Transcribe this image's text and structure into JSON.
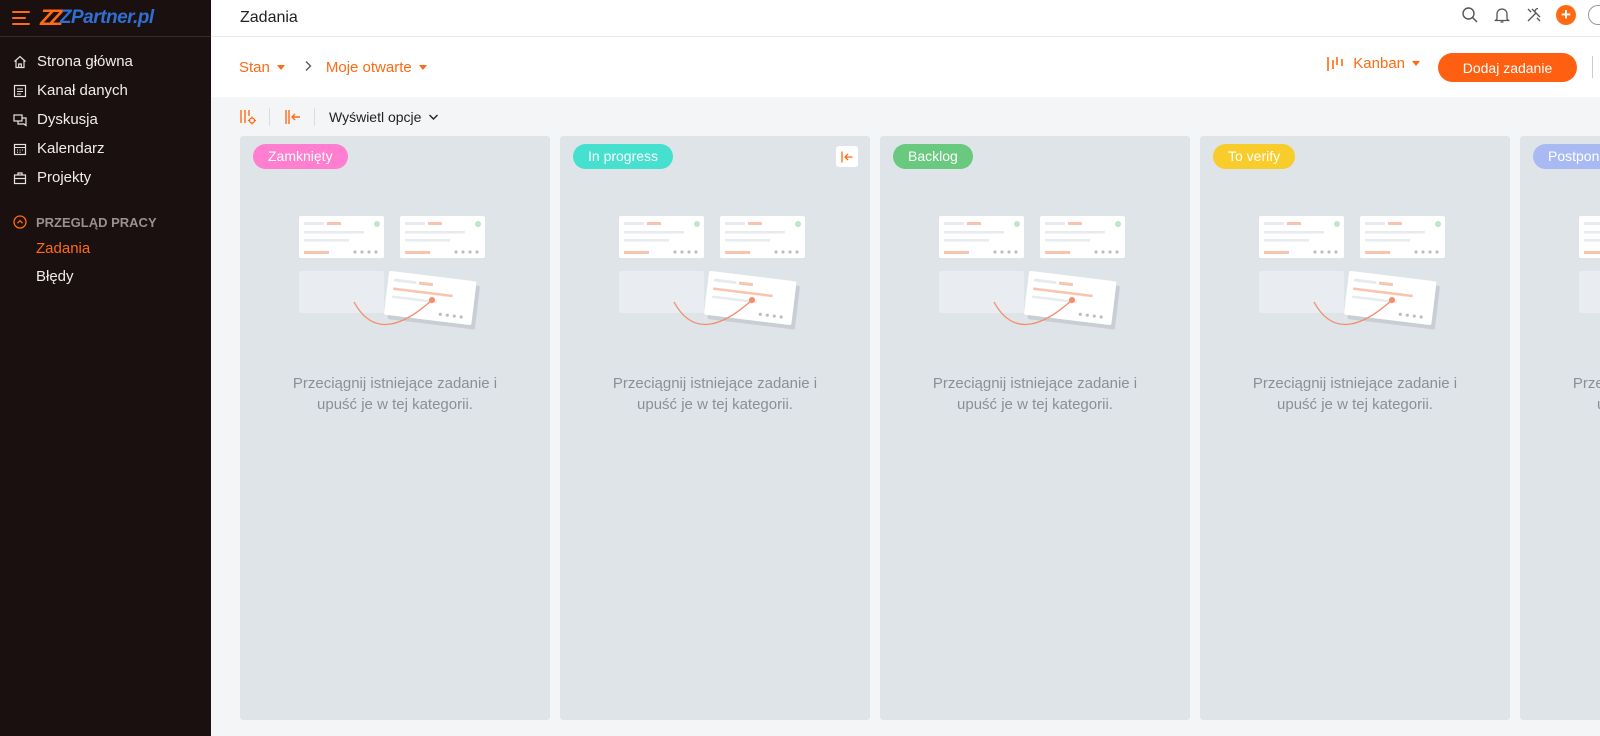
{
  "app": {
    "logo_text": "ZPartner.pl",
    "page_title": "Zadania"
  },
  "sidebar": {
    "items": [
      {
        "label": "Strona główna",
        "icon": "home-icon"
      },
      {
        "label": "Kanał danych",
        "icon": "feed-icon"
      },
      {
        "label": "Dyskusja",
        "icon": "discussion-icon"
      },
      {
        "label": "Kalendarz",
        "icon": "calendar-icon"
      },
      {
        "label": "Projekty",
        "icon": "briefcase-icon"
      }
    ],
    "section": {
      "title": "PRZEGLĄD PRACY",
      "items": [
        {
          "label": "Zadania",
          "active": true
        },
        {
          "label": "Błędy",
          "active": false
        }
      ]
    }
  },
  "filters": {
    "state": "Stan",
    "view_filter": "Moje otwarte"
  },
  "layout_selector": "Kanban",
  "add_button": "Dodaj zadanie",
  "toolbar": {
    "display_options": "Wyświetl opcje"
  },
  "columns": [
    {
      "label": "Zamknięty",
      "color": "#ff7ed0",
      "empty_message": "Przeciągnij istniejące zadanie i\nupuść je w tej kategorii."
    },
    {
      "label": "In progress",
      "color": "#46e0cf",
      "empty_message": "Przeciągnij istniejące zadanie i\nupuść je w tej kategorii."
    },
    {
      "label": "Backlog",
      "color": "#69c97f",
      "empty_message": "Przeciągnij istniejące zadanie i\nupuść je w tej kategorii."
    },
    {
      "label": "To verify",
      "color": "#f8cc2a",
      "empty_message": "Przeciągnij istniejące zadanie i\nupuść je w tej kategorii."
    },
    {
      "label": "Postponed",
      "color": "#a9b9f2",
      "empty_message": "Przeciągnij istniejące zadanie i\nupuść je w tej kategorii."
    }
  ],
  "colors": {
    "accent": "#ff6a13",
    "sidebar_bg": "#1b1010",
    "column_bg": "#dfe4e9"
  }
}
